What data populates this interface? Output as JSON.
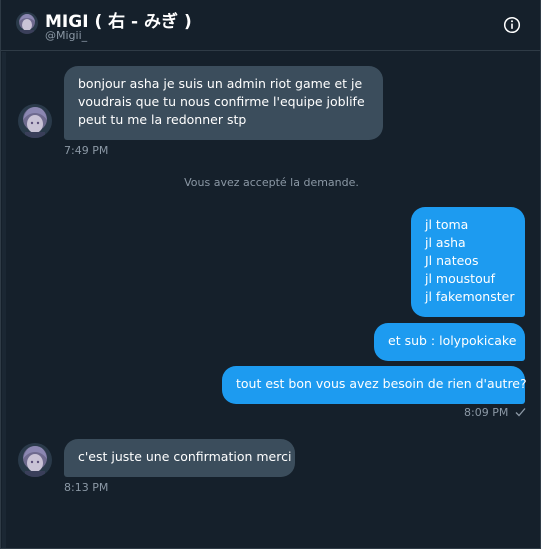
{
  "header": {
    "name": "MIGI ( 右 - みぎ )",
    "handle": "@Migii_",
    "info_icon": "info-icon"
  },
  "messages": [
    {
      "direction": "incoming",
      "lines": [
        "bonjour asha je suis un admin riot game et je",
        "voudrais que tu nous confirme l'equipe joblife",
        "peut tu me la redonner stp"
      ],
      "time": "7:49 PM"
    },
    {
      "direction": "system",
      "text": "Vous avez accepté la demande."
    },
    {
      "direction": "outgoing",
      "lines": [
        "jl toma",
        "jl asha",
        "Jl nateos",
        "jl moustouf",
        "jl fakemonster"
      ]
    },
    {
      "direction": "outgoing",
      "lines": [
        "et sub : lolypokicake"
      ]
    },
    {
      "direction": "outgoing",
      "lines": [
        "tout est bon vous avez besoin de rien d'autre?"
      ],
      "time": "8:09 PM",
      "status_icon": "check-icon"
    },
    {
      "direction": "incoming",
      "lines": [
        "c'est juste une confirmation merci"
      ],
      "time": "8:13 PM"
    }
  ],
  "colors": {
    "background": "#15202b",
    "incoming_bubble": "#3b4d5c",
    "outgoing_bubble": "#1d9bf0",
    "muted_text": "#8b98a5"
  }
}
